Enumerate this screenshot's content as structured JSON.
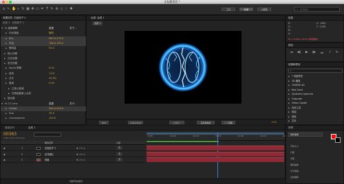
{
  "window": {
    "title": "无标题项目 *"
  },
  "toolbar": {
    "workspace_options": [
      "工具",
      "标准",
      "小屏幕"
    ],
    "search_placeholder": "搜索帮助"
  },
  "effects_panel": {
    "tab": "效果控件: 白色粒子 2",
    "breadcrumb": "合成 1 · 白色粒子 2",
    "rows": [
      {
        "label": "fx 高斯模糊",
        "value": "重置",
        "extra": "关于..."
      },
      {
        "label": "闪光强度",
        "value": "随机"
      },
      {
        "label": "中心",
        "value": "960.0,270.0"
      },
      {
        "label": "半径",
        "value": "768.0,765.0"
      },
      {
        "label": "随机量",
        "value": "94.0"
      },
      {
        "label": "核心设置",
        "value": ""
      },
      {
        "label": "分支设置",
        "value": ""
      },
      {
        "label": "发光设置",
        "value": ""
      },
      {
        "label": "Alpha 障碍",
        "value": "0.00"
      },
      {
        "label": "湍流",
        "value": "1.00"
      },
      {
        "label": "分叉",
        "value": "25.0%"
      },
      {
        "label": "衰减",
        "value": "0.50"
      },
      {
        "label": "主核心衰减",
        "value": ""
      },
      {
        "label": "在原始图像上合成",
        "value": ""
      },
      {
        "label": "复杂度",
        "value": ""
      },
      {
        "label": "fx CC Lens",
        "value": "重置",
        "extra": "关于..."
      },
      {
        "label": "Center",
        "value": "960.0,540.0"
      },
      {
        "label": "Size",
        "value": "39.0"
      },
      {
        "label": "Convergence",
        "value": "100.0"
      }
    ]
  },
  "composition": {
    "tab": "合成: 合成 1",
    "sub_tab": "合成 1",
    "zoom": "50%",
    "timecode": "0;00;03;02",
    "quality": "二分之一",
    "camera": "活动摄像机",
    "views": "1 个视图",
    "offset": "+0.0"
  },
  "info_panel": {
    "tab": "信息",
    "r": "R :",
    "g": "G :",
    "b": "B :",
    "a": "A :",
    "x": "X : 1084",
    "y": "Y : 1236",
    "footer": "预览",
    "warning": "Bn: 14.000  |  00;00  (非常慢的)"
  },
  "preview_panel": {
    "tab": "预览"
  },
  "effects_presets": {
    "tab": "效果和预设",
    "search_placeholder": "P.",
    "items": [
      "* 动画预设",
      "3D 通道",
      "CINEMA 4D",
      "Red Giant",
      "Synthetic Aperture",
      "Trapcode",
      "Video Copilot",
      "实用工具",
      "扭曲",
      "抠像",
      "文本"
    ]
  },
  "timeline": {
    "tab": "合成 1",
    "tab2": "渲染队列",
    "timecode": "00363",
    "subtime": "0;00;12;03 (30.00 fps)",
    "search_placeholder": "",
    "headers": [
      "图层名称",
      "父级"
    ],
    "layers": [
      {
        "num": "1",
        "name": "白色粒子 2",
        "color": "#000000",
        "parent": "无"
      },
      {
        "num": "2",
        "name": "[白色粒]",
        "color": "#111111",
        "parent": "无"
      },
      {
        "num": "3",
        "name": "背景",
        "color": "#c0272d",
        "parent": "无"
      }
    ],
    "ruler": [
      "0:00f",
      "00:15f",
      "01:00f",
      "01:15f",
      "02:00f",
      "02:15f",
      "03:00f"
    ],
    "footer": "切换开关/模式"
  },
  "character_panel": {
    "tab": "字符",
    "font": "微软雅黑",
    "fill_color": "#ff0000",
    "labels": [
      "字体大小",
      "行距",
      "字距",
      "垂直缩放",
      "水平缩放",
      "基线偏移"
    ]
  },
  "colors": {
    "accent": "#e0a43a",
    "track": "#8e2a35",
    "timeline_marker": "#4b9d3a",
    "lightning": "#2aa3ff"
  }
}
